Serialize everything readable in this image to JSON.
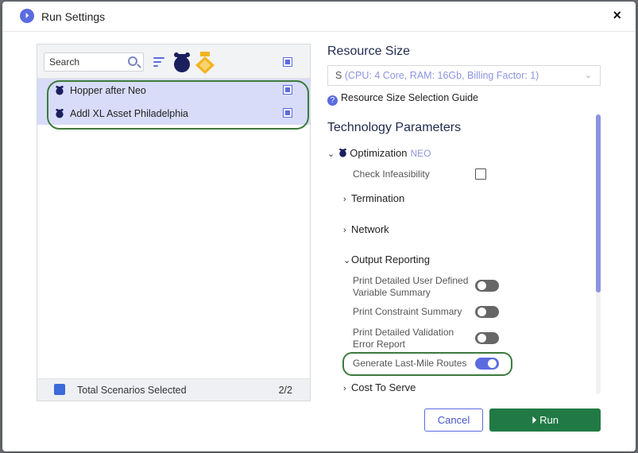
{
  "dialog": {
    "title": "Run Settings",
    "close_glyph": "×",
    "logo_glyph": "⏵"
  },
  "scenario_panel": {
    "search_placeholder": "Search",
    "rows": [
      {
        "label": "Hopper after Neo",
        "checked": true
      },
      {
        "label": "Addl XL Asset Philadelphia",
        "checked": true
      }
    ],
    "footer": {
      "label": "Total Scenarios Selected",
      "count": "2/2"
    }
  },
  "resource": {
    "title": "Resource Size",
    "selected_size": "S",
    "selected_detail": "(CPU: 4 Core, RAM: 16Gb, Billing Factor: 1)",
    "guide_link": "Resource Size Selection Guide"
  },
  "technology": {
    "title": "Technology Parameters",
    "engine": {
      "label": "Optimization",
      "tag": "NEO"
    },
    "check_infeasibility": {
      "label": "Check Infeasibility",
      "checked": false
    },
    "sections": {
      "termination": "Termination",
      "network": "Network",
      "output_reporting": "Output Reporting",
      "cost_to_serve": "Cost To Serve"
    },
    "toggles": [
      {
        "label_line1": "Print Detailed User Defined",
        "label_line2": "Variable Summary",
        "on": false
      },
      {
        "label_line1": "Print Constraint Summary",
        "label_line2": "",
        "on": false
      },
      {
        "label_line1": "Print Detailed Validation",
        "label_line2": "Error Report",
        "on": false
      },
      {
        "label_line1": "Generate Last-Mile Routes",
        "label_line2": "",
        "on": true
      }
    ]
  },
  "actions": {
    "cancel": "Cancel",
    "run": "Run",
    "run_glyph": "⏵"
  },
  "colors": {
    "accent": "#5b6be0",
    "run_button": "#217a45",
    "highlight_outline": "#3d7a3d",
    "selected_rows": "#d8dcf8"
  }
}
